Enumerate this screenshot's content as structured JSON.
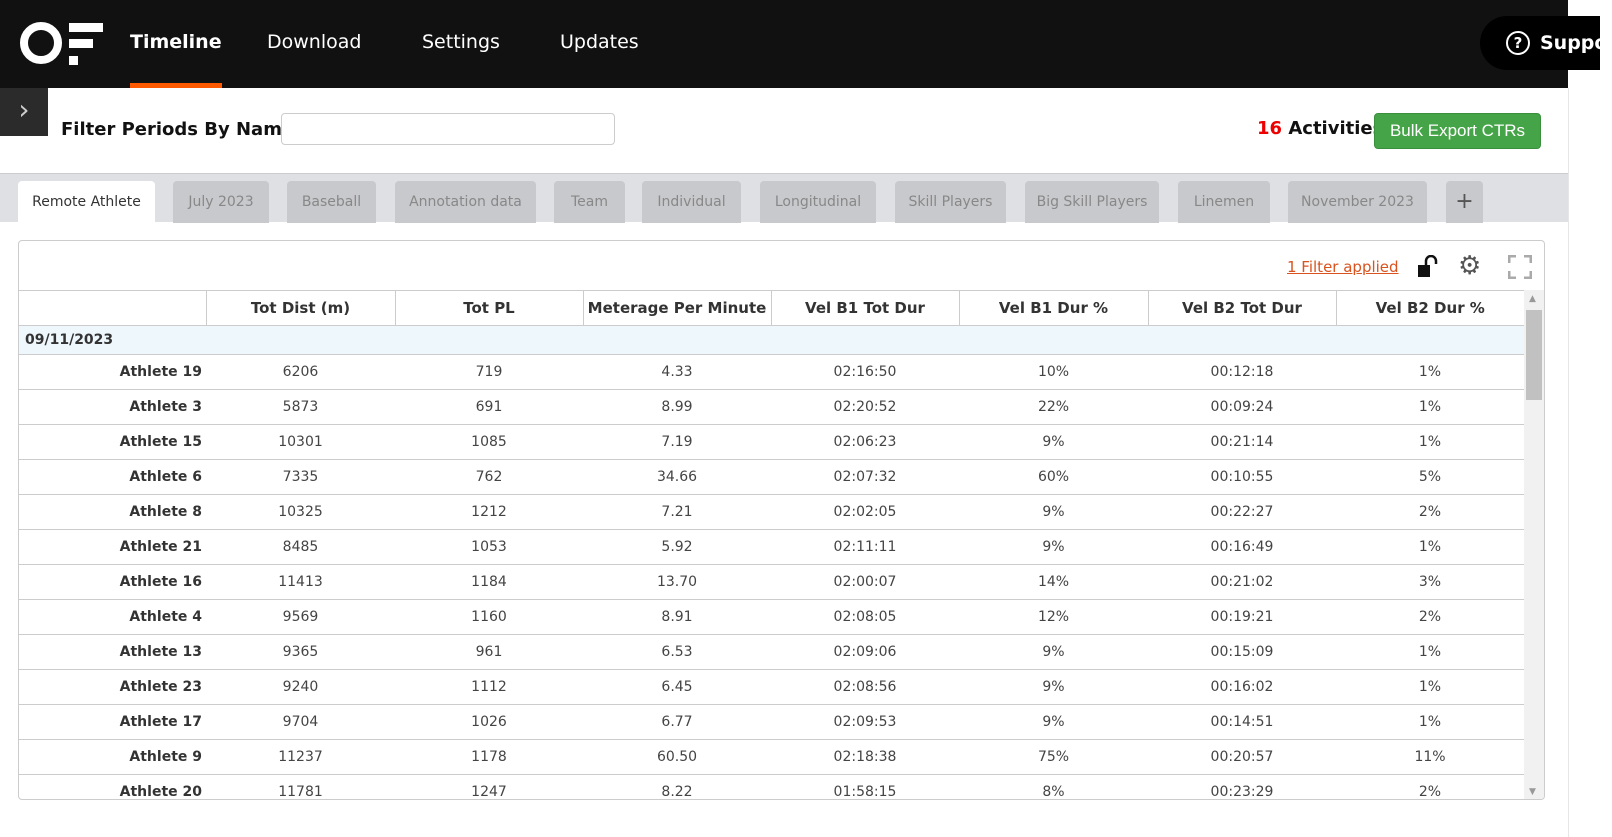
{
  "nav": {
    "items": [
      "Timeline",
      "Download",
      "Settings",
      "Updates"
    ],
    "active": "Timeline",
    "support": "Support"
  },
  "filter": {
    "label": "Filter Periods By Name",
    "value": "",
    "placeholder": ""
  },
  "activities": {
    "count": "16",
    "label": "Activities"
  },
  "bulk_export": "Bulk Export CTRs",
  "tabs": [
    "Remote Athlete",
    "July 2023",
    "Baseball",
    "Annotation data",
    "Team",
    "Individual",
    "Longitudinal",
    "Skill Players",
    "Big Skill Players",
    "Linemen",
    "November 2023"
  ],
  "active_tab": "Remote Athlete",
  "add_tab": "+",
  "filter_applied": "1 Filter applied",
  "table": {
    "columns": [
      "",
      "Tot Dist (m)",
      "Tot PL",
      "Meterage Per Minute",
      "Vel B1 Tot Dur",
      "Vel B1 Dur %",
      "Vel B2 Tot Dur",
      "Vel B2 Dur %"
    ],
    "group": "09/11/2023",
    "rows": [
      [
        "Athlete 19",
        "6206",
        "719",
        "4.33",
        "02:16:50",
        "10%",
        "00:12:18",
        "1%"
      ],
      [
        "Athlete 3",
        "5873",
        "691",
        "8.99",
        "02:20:52",
        "22%",
        "00:09:24",
        "1%"
      ],
      [
        "Athlete 15",
        "10301",
        "1085",
        "7.19",
        "02:06:23",
        "9%",
        "00:21:14",
        "1%"
      ],
      [
        "Athlete 6",
        "7335",
        "762",
        "34.66",
        "02:07:32",
        "60%",
        "00:10:55",
        "5%"
      ],
      [
        "Athlete 8",
        "10325",
        "1212",
        "7.21",
        "02:02:05",
        "9%",
        "00:22:27",
        "2%"
      ],
      [
        "Athlete 21",
        "8485",
        "1053",
        "5.92",
        "02:11:11",
        "9%",
        "00:16:49",
        "1%"
      ],
      [
        "Athlete 16",
        "11413",
        "1184",
        "13.70",
        "02:00:07",
        "14%",
        "00:21:02",
        "3%"
      ],
      [
        "Athlete 4",
        "9569",
        "1160",
        "8.91",
        "02:08:05",
        "12%",
        "00:19:21",
        "2%"
      ],
      [
        "Athlete 13",
        "9365",
        "961",
        "6.53",
        "02:09:06",
        "9%",
        "00:15:09",
        "1%"
      ],
      [
        "Athlete 23",
        "9240",
        "1112",
        "6.45",
        "02:08:56",
        "9%",
        "00:16:02",
        "1%"
      ],
      [
        "Athlete 17",
        "9704",
        "1026",
        "6.77",
        "02:09:53",
        "9%",
        "00:14:51",
        "1%"
      ],
      [
        "Athlete 9",
        "11237",
        "1178",
        "60.50",
        "02:18:38",
        "75%",
        "00:20:57",
        "11%"
      ],
      [
        "Athlete 20",
        "11781",
        "1247",
        "8.22",
        "01:58:15",
        "8%",
        "00:23:29",
        "2%"
      ]
    ]
  },
  "colors": {
    "accent": "#ff5a00",
    "button": "#45a447",
    "count": "#ee0000",
    "link": "#d9531e"
  }
}
